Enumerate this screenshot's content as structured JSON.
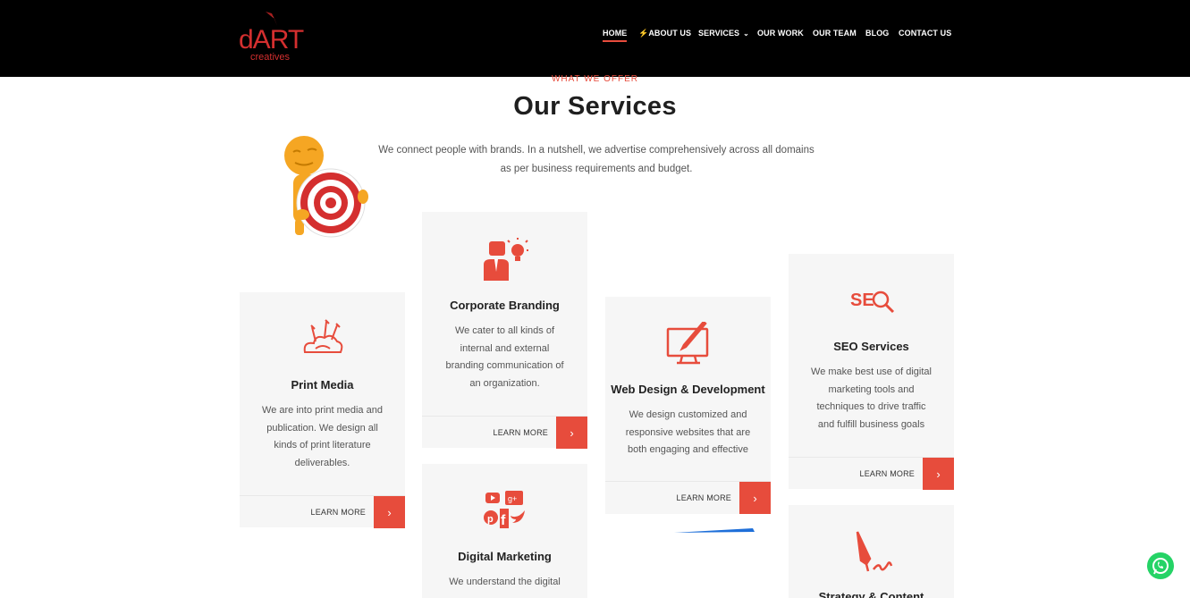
{
  "brand": {
    "name": "dART",
    "tagline": "creatives"
  },
  "nav": {
    "home": "HOME",
    "about": "ABOUT US",
    "services": "SERVICES",
    "work": "OUR WORK",
    "team": "OUR TEAM",
    "blog": "BLOG",
    "contact": "CONTACT US"
  },
  "section": {
    "eyebrow": "WHAT WE OFFER",
    "title": "Our Services",
    "intro": "We connect people with brands. In a nutshell, we advertise comprehensively across all domains as per business requirements and budget."
  },
  "cards": [
    {
      "title": "Print Media",
      "desc": "We are into print media and publication. We design all kinds of print literature deliverables.",
      "cta": "LEARN MORE",
      "icon": "print-media-icon"
    },
    {
      "title": "Corporate Branding",
      "desc": "We cater to all kinds of internal and external branding communication of an organization.",
      "cta": "LEARN MORE",
      "icon": "corporate-branding-icon"
    },
    {
      "title": "Web Design & Development",
      "desc": "We design customized and responsive websites that are both engaging and effective",
      "cta": "LEARN MORE",
      "icon": "monitor-pen-icon"
    },
    {
      "title": "SEO Services",
      "desc": "We make best use of digital marketing tools and techniques to drive traffic and fulfill business goals",
      "cta": "LEARN MORE",
      "icon": "seo-icon"
    },
    {
      "title": "Digital Marketing",
      "desc": "We understand the digital",
      "icon": "social-media-icon"
    },
    {
      "title": "Strategy & Content",
      "icon": "pen-signature-icon"
    }
  ],
  "colors": {
    "accent": "#e74c3c",
    "header_bg": "#000000",
    "card_bg": "#f6f6f6",
    "whatsapp": "#25d366"
  }
}
